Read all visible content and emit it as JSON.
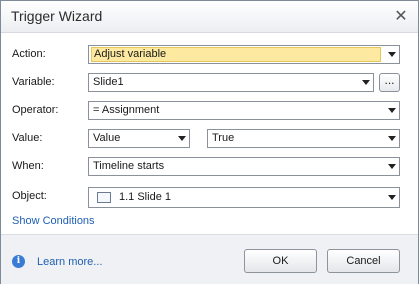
{
  "window": {
    "title": "Trigger Wizard",
    "close_glyph": "✕"
  },
  "form": {
    "action": {
      "label": "Action:",
      "value": "Adjust variable"
    },
    "variable": {
      "label": "Variable:",
      "value": "Slide1",
      "browse_label": "..."
    },
    "operator": {
      "label": "Operator:",
      "value": "= Assignment"
    },
    "value": {
      "label": "Value:",
      "type_value": "Value",
      "value": "True"
    },
    "when": {
      "label": "When:",
      "value": "Timeline starts"
    },
    "object": {
      "label": "Object:",
      "value": "1.1 Slide 1",
      "icon": "slide-icon"
    },
    "show_conditions": "Show Conditions"
  },
  "footer": {
    "info_glyph": "i",
    "learn_more": "Learn more...",
    "ok_label": "OK",
    "cancel_label": "Cancel"
  },
  "colors": {
    "highlight": "#fde9a0",
    "link": "#1f5fb3"
  }
}
